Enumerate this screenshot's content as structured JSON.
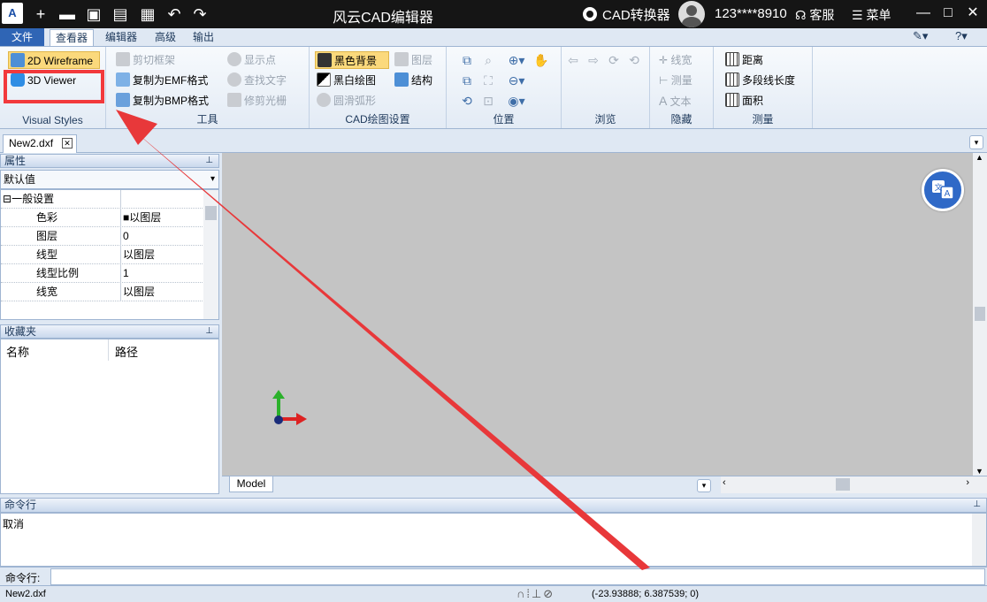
{
  "app": {
    "title": "风云CAD编辑器",
    "converter_label": "CAD转换器",
    "user": "123****8910",
    "service_label": "客服",
    "menu_label": "菜单",
    "logo_text": "A",
    "minimize": "—",
    "maximize": "□",
    "close": "✕"
  },
  "quick_access": {
    "new_icon": "+",
    "open_icon": "▬",
    "save_icon": "▣",
    "saveas_icon": "▤",
    "print_icon": "▦",
    "undo_icon": "↶",
    "redo_icon": "↷"
  },
  "ribbon_tabs": [
    "文件",
    "查看器",
    "编辑器",
    "高级",
    "输出"
  ],
  "ribbon": {
    "visual_styles": {
      "label": "Visual Styles",
      "wireframe": "2D Wireframe",
      "viewer3d": "3D Viewer"
    },
    "tools": {
      "label": "工具",
      "clip_frame": "剪切框架",
      "copy_emf": "复制为EMF格式",
      "copy_bmp": "复制为BMP格式",
      "show_points": "显示点",
      "find_text": "查找文字",
      "trim_raster": "修剪光栅"
    },
    "cad_settings": {
      "label": "CAD绘图设置",
      "black_bg": "黑色背景",
      "bw_drawing": "黑白绘图",
      "smooth_arc": "圆滑弧形",
      "layers": "图层",
      "structure": "结构"
    },
    "position": {
      "label": "位置"
    },
    "browse": {
      "label": "浏览"
    },
    "hide": {
      "label": "隐藏",
      "line_width": "线宽",
      "measure": "测量",
      "text": "文本"
    },
    "measure": {
      "label": "测量",
      "distance": "距离",
      "polyline_length": "多段线长度",
      "area": "面积"
    }
  },
  "document_tab": "New2.dxf",
  "properties": {
    "title": "属性",
    "selector": "默认值",
    "category": "一般设置",
    "rows": [
      {
        "key": "色彩",
        "value": "■以图层"
      },
      {
        "key": "图层",
        "value": "0"
      },
      {
        "key": "线型",
        "value": "以图层"
      },
      {
        "key": "线型比例",
        "value": "1"
      },
      {
        "key": "线宽",
        "value": "以图层"
      }
    ]
  },
  "favorites": {
    "title": "收藏夹",
    "col_name": "名称",
    "col_path": "路径"
  },
  "canvas": {
    "model_tab": "Model"
  },
  "command": {
    "title": "命令行",
    "output": "取消",
    "prompt_label": "命令行:",
    "input_value": ""
  },
  "status": {
    "file": "New2.dxf",
    "coords": "(-23.93888; 6.387539; 0)"
  }
}
